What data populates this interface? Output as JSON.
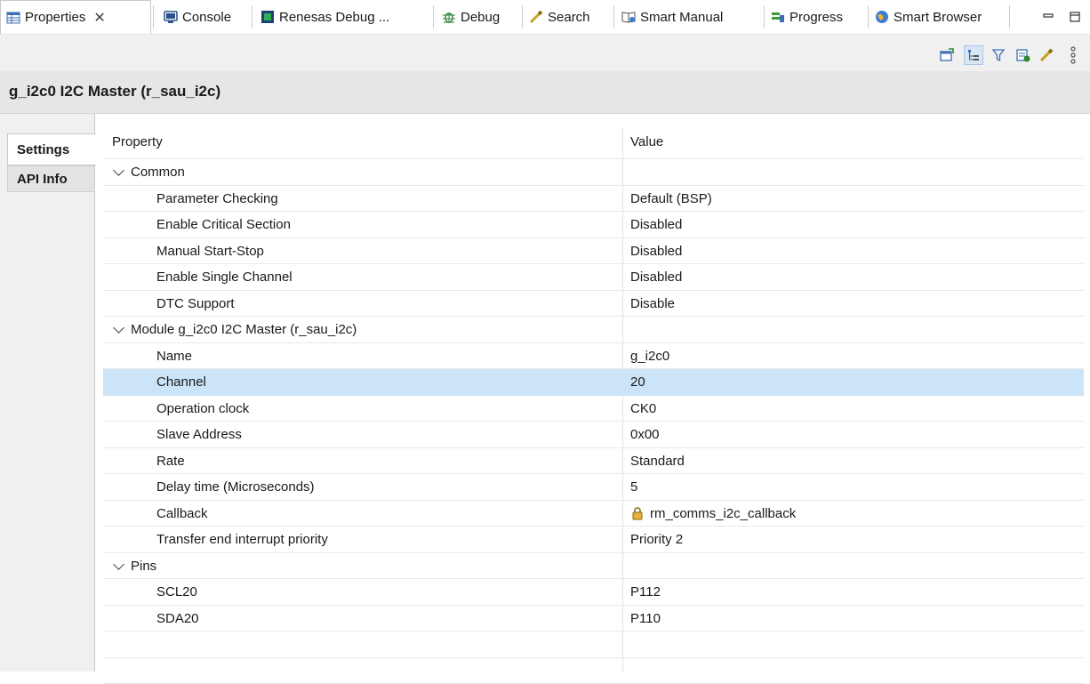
{
  "tabs": [
    {
      "label": "Properties",
      "icon": "properties-icon",
      "active": true
    },
    {
      "label": "Console",
      "icon": "console-icon"
    },
    {
      "label": "Renesas Debug ...",
      "icon": "renesas-debug-icon"
    },
    {
      "label": "Debug",
      "icon": "debug-bug-icon"
    },
    {
      "label": "Search",
      "icon": "search-flashlight-icon"
    },
    {
      "label": "Smart Manual",
      "icon": "smart-manual-icon"
    },
    {
      "label": "Progress",
      "icon": "progress-icon"
    },
    {
      "label": "Smart Browser",
      "icon": "smart-browser-icon"
    }
  ],
  "close_glyph": "✕",
  "panel_title": "g_i2c0 I2C Master (r_sau_i2c)",
  "side_tabs": [
    {
      "label": "Settings"
    },
    {
      "label": "API Info"
    }
  ],
  "columns": {
    "property": "Property",
    "value": "Value"
  },
  "rows": [
    {
      "type": "group",
      "property": "Common",
      "value": ""
    },
    {
      "type": "item",
      "property": "Parameter Checking",
      "value": "Default (BSP)"
    },
    {
      "type": "item",
      "property": "Enable Critical Section",
      "value": "Disabled"
    },
    {
      "type": "item",
      "property": "Manual Start-Stop",
      "value": "Disabled"
    },
    {
      "type": "item",
      "property": "Enable Single Channel",
      "value": "Disabled"
    },
    {
      "type": "item",
      "property": "DTC Support",
      "value": "Disable"
    },
    {
      "type": "group",
      "property": "Module g_i2c0 I2C Master (r_sau_i2c)",
      "value": ""
    },
    {
      "type": "item",
      "property": "Name",
      "value": "g_i2c0"
    },
    {
      "type": "item",
      "property": "Channel",
      "value": "20",
      "selected": true
    },
    {
      "type": "item",
      "property": "Operation clock",
      "value": "CK0"
    },
    {
      "type": "item",
      "property": "Slave Address",
      "value": "0x00"
    },
    {
      "type": "item",
      "property": "Rate",
      "value": "Standard"
    },
    {
      "type": "item",
      "property": "Delay time (Microseconds)",
      "value": "5"
    },
    {
      "type": "item",
      "property": "Callback",
      "value": "rm_comms_i2c_callback",
      "locked": true
    },
    {
      "type": "item",
      "property": "Transfer end interrupt priority",
      "value": "Priority 2"
    },
    {
      "type": "group",
      "property": "Pins",
      "value": ""
    },
    {
      "type": "item",
      "property": "SCL20",
      "value": "P112"
    },
    {
      "type": "item",
      "property": "SDA20",
      "value": "P110"
    },
    {
      "type": "empty",
      "property": "",
      "value": ""
    },
    {
      "type": "empty",
      "property": "",
      "value": ""
    }
  ],
  "colors": {
    "selection": "#cce4f7",
    "title_bg": "#e6e6e6",
    "toolbar_bg": "#f0f0f0"
  }
}
